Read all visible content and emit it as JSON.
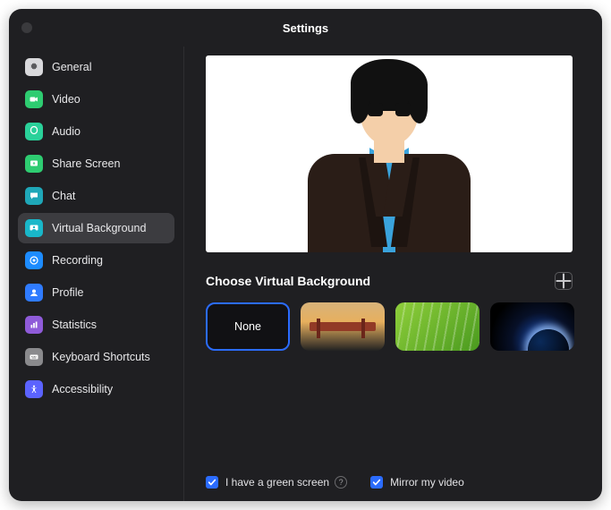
{
  "window": {
    "title": "Settings"
  },
  "sidebar": {
    "items": [
      {
        "label": "General",
        "icon": "gear-icon",
        "color": "#d9d9dc"
      },
      {
        "label": "Video",
        "icon": "video-icon",
        "color": "#2ecc71"
      },
      {
        "label": "Audio",
        "icon": "audio-icon",
        "color": "#2ad19a"
      },
      {
        "label": "Share Screen",
        "icon": "share-icon",
        "color": "#2ecc71"
      },
      {
        "label": "Chat",
        "icon": "chat-icon",
        "color": "#1fa7b8"
      },
      {
        "label": "Virtual Background",
        "icon": "vb-icon",
        "color": "#19b7c9",
        "selected": true
      },
      {
        "label": "Recording",
        "icon": "record-icon",
        "color": "#1d8cff"
      },
      {
        "label": "Profile",
        "icon": "profile-icon",
        "color": "#2f7bff"
      },
      {
        "label": "Statistics",
        "icon": "stats-icon",
        "color": "#8f5bd9"
      },
      {
        "label": "Keyboard Shortcuts",
        "icon": "keyboard-icon",
        "color": "#8a8a8d"
      },
      {
        "label": "Accessibility",
        "icon": "accessibility-icon",
        "color": "#5b63ff"
      }
    ]
  },
  "section": {
    "title": "Choose Virtual Background",
    "tiles": [
      {
        "kind": "none",
        "label": "None"
      },
      {
        "kind": "bridge",
        "label": ""
      },
      {
        "kind": "grass",
        "label": ""
      },
      {
        "kind": "space",
        "label": ""
      }
    ]
  },
  "options": {
    "green_screen": "I have a green screen",
    "mirror": "Mirror my video"
  }
}
